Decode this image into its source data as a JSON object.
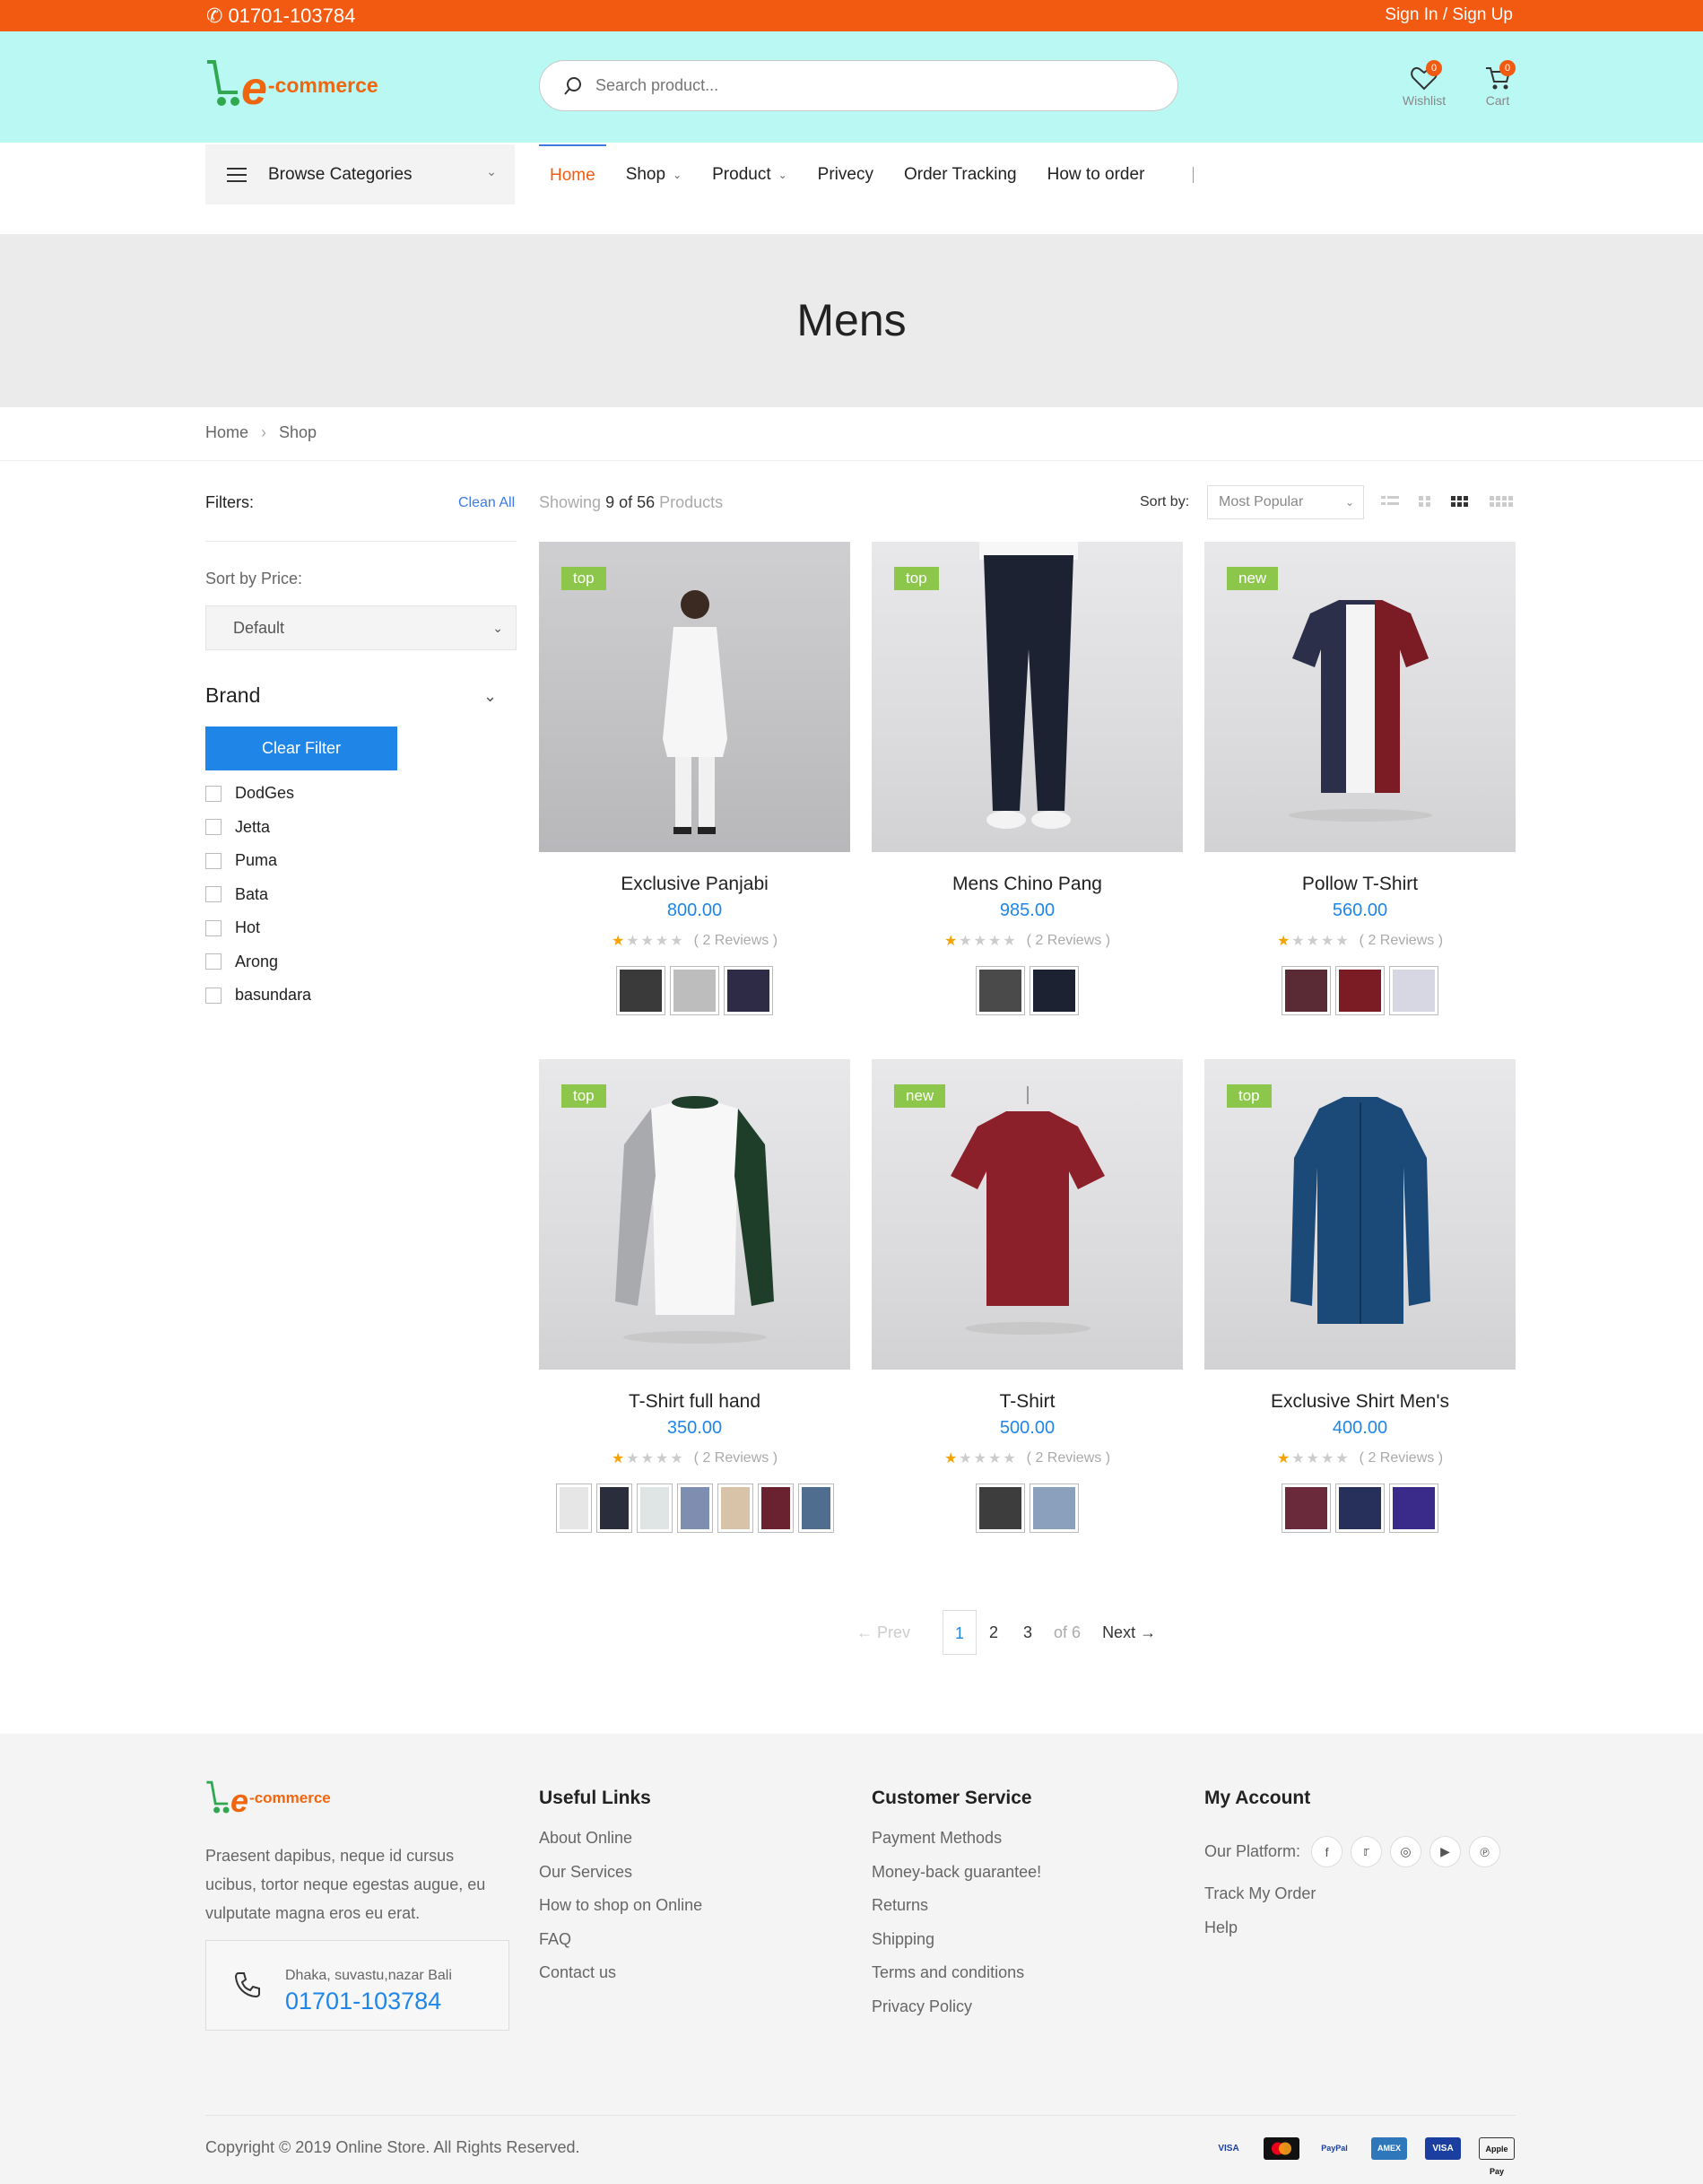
{
  "topbar": {
    "phone": "01701-103784",
    "auth": "Sign In / Sign Up"
  },
  "header": {
    "logo_letter": "e",
    "logo_text": "-commerce",
    "search_placeholder": "Search product...",
    "wishlist_label": "Wishlist",
    "wishlist_count": "0",
    "cart_label": "Cart",
    "cart_count": "0"
  },
  "nav": {
    "browse_categories": "Browse Categories",
    "items": [
      {
        "label": "Home"
      },
      {
        "label": "Shop"
      },
      {
        "label": "Product"
      },
      {
        "label": "Privecy"
      },
      {
        "label": "Order Tracking"
      },
      {
        "label": "How to order"
      }
    ]
  },
  "hero": {
    "title": "Mens"
  },
  "breadcrumb": {
    "home": "Home",
    "current": "Shop"
  },
  "sidebar": {
    "filters_label": "Filters:",
    "clean_all": "Clean All",
    "sort_price_label": "Sort by Price:",
    "sort_price_value": "Default",
    "brand_label": "Brand",
    "clear_filter": "Clear Filter",
    "brands": [
      "DodGes",
      "Jetta",
      "Puma",
      "Bata",
      "Hot",
      "Arong",
      "basundara"
    ]
  },
  "toolbar": {
    "showing_prefix": "Showing",
    "showing_count": "9 of 56",
    "showing_suffix": "Products",
    "sort_by_label": "Sort by:",
    "sort_by_value": "Most Popular"
  },
  "products": [
    {
      "name": "Exclusive Panjabi",
      "price": "800.00",
      "tag": "top",
      "reviews": "( 2 Reviews )"
    },
    {
      "name": "Mens Chino Pang",
      "price": "985.00",
      "tag": "top",
      "reviews": "( 2 Reviews )"
    },
    {
      "name": "Pollow T-Shirt",
      "price": "560.00",
      "tag": "new",
      "reviews": "( 2 Reviews )"
    },
    {
      "name": "T-Shirt full hand",
      "price": "350.00",
      "tag": "top",
      "reviews": "( 2 Reviews )"
    },
    {
      "name": "T-Shirt",
      "price": "500.00",
      "tag": "new",
      "reviews": "( 2 Reviews )"
    },
    {
      "name": "Exclusive Shirt Men's",
      "price": "400.00",
      "tag": "top",
      "reviews": "( 2 Reviews )"
    }
  ],
  "pagination": {
    "prev": "Prev",
    "pages": [
      "1",
      "2",
      "3"
    ],
    "of": "of 6",
    "next": "Next"
  },
  "footer": {
    "logo_letter": "e",
    "logo_text": "-commerce",
    "description": "Praesent dapibus, neque id cursus ucibus, tortor neque egestas augue, eu vulputate magna eros eu erat.",
    "address": "Dhaka, suvastu,nazar Bali",
    "phone": "01701-103784",
    "useful_title": "Useful Links",
    "useful_links": [
      "About Online",
      "Our Services",
      "How to shop on Online",
      "FAQ",
      "Contact us"
    ],
    "service_title": "Customer Service",
    "service_links": [
      "Payment Methods",
      "Money-back guarantee!",
      "Returns",
      "Shipping",
      "Terms and conditions",
      "Privacy Policy"
    ],
    "account_title": "My Account",
    "platform_label": "Our Platform:",
    "account_links": [
      "Track My Order",
      "Help"
    ],
    "copyright": "Copyright © 2019 Online Store. All Rights Reserved.",
    "payments": [
      "VISA",
      "MC",
      "PayPal",
      "AMEX",
      "VISA",
      "Apple Pay"
    ]
  },
  "colors": {
    "accent": "#f35a11",
    "header_bg": "#b9f8f3",
    "primary": "#1f86e8",
    "tag": "#8cc74b"
  }
}
